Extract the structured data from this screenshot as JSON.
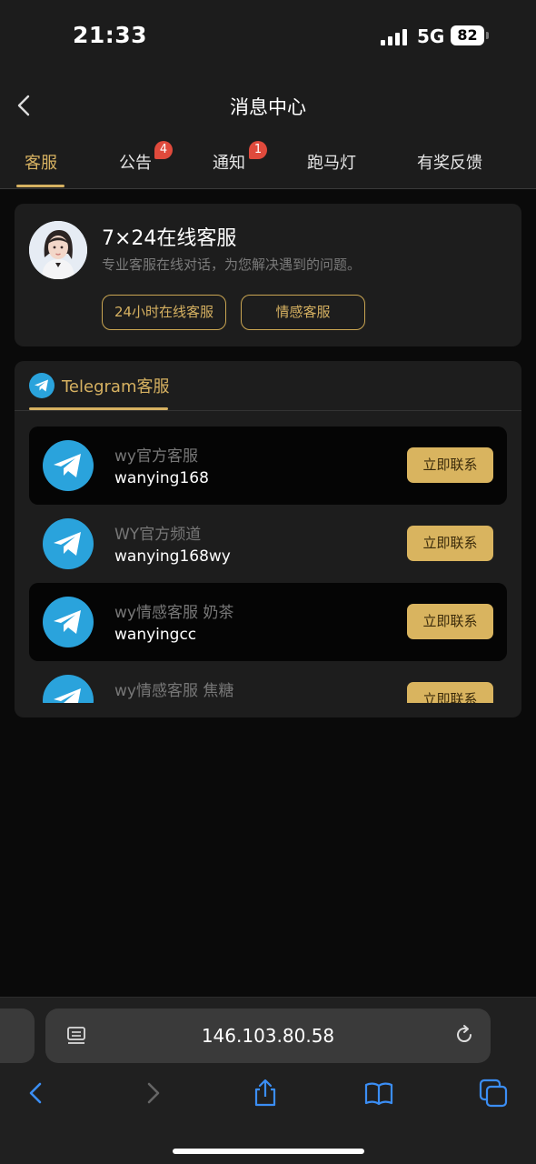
{
  "status_bar": {
    "time": "21:33",
    "network": "5G",
    "battery": "82"
  },
  "header": {
    "title": "消息中心"
  },
  "tabs": [
    {
      "label": "客服",
      "active": true
    },
    {
      "label": "公告",
      "badge": "4"
    },
    {
      "label": "通知",
      "badge": "1"
    },
    {
      "label": "跑马灯"
    },
    {
      "label": "有奖反馈"
    }
  ],
  "service": {
    "title": "7×24在线客服",
    "subtitle": "专业客服在线对话，为您解决遇到的问题。",
    "buttons": [
      "24小时在线客服",
      "情感客服"
    ]
  },
  "telegram": {
    "section_label": "Telegram客服",
    "contacts": [
      {
        "name": "wy官方客服",
        "handle": "wanying168",
        "action": "立即联系"
      },
      {
        "name": "WY官方频道",
        "handle": "wanying168wy",
        "action": "立即联系"
      },
      {
        "name": "wy情感客服 奶茶",
        "handle": "wanyingcc",
        "action": "立即联系"
      },
      {
        "name": "wy情感客服 焦糖",
        "handle": "",
        "action": "立即联系"
      }
    ]
  },
  "browser": {
    "url": "146.103.80.58"
  },
  "colors": {
    "accent": "#d6b161",
    "badge": "#e04a3c",
    "telegram": "#2aa3dc"
  }
}
